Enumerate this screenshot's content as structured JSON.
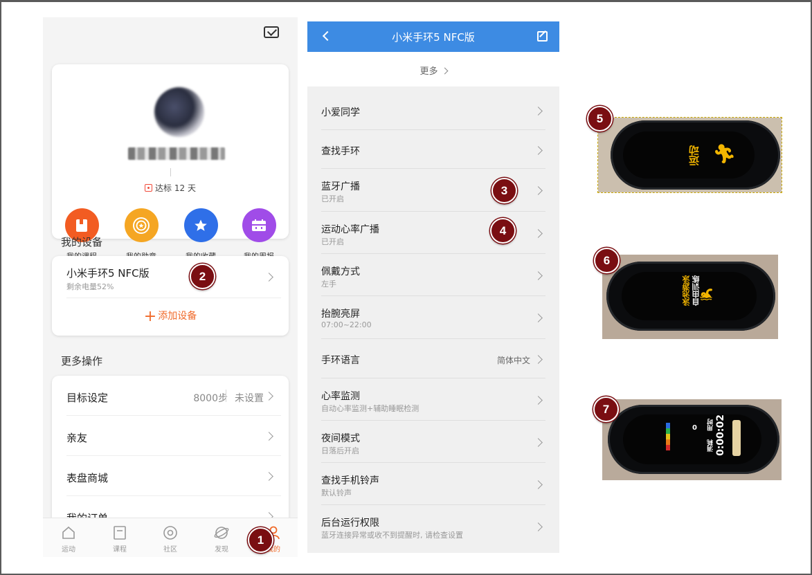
{
  "profile": {
    "badge_text": "达标 12 天",
    "shortcuts": [
      {
        "label": "我的课程",
        "color": "#f25c22"
      },
      {
        "label": "我的勋章",
        "color": "#f5a623"
      },
      {
        "label": "我的收藏",
        "color": "#2f6fe8"
      },
      {
        "label": "我的周报",
        "color": "#a04ce8"
      }
    ],
    "devices_title": "我的设备",
    "device": {
      "name": "小米手环5 NFC版",
      "battery": "剩余电量52%"
    },
    "add_device": "添加设备",
    "more_ops_title": "更多操作",
    "ops": [
      {
        "label": "目标设定",
        "value": "8000步",
        "value2": "未设置"
      },
      {
        "label": "亲友"
      },
      {
        "label": "表盘商城"
      },
      {
        "label": "我的订单"
      }
    ],
    "tabs": [
      "运动",
      "课程",
      "社区",
      "发现",
      "我的"
    ]
  },
  "device_settings": {
    "title": "小米手环5 NFC版",
    "more": "更多",
    "rows": [
      {
        "label": "小爱同学",
        "sub": "",
        "value": ""
      },
      {
        "label": "查找手环",
        "sub": "",
        "value": ""
      },
      {
        "label": "蓝牙广播",
        "sub": "已开启",
        "value": ""
      },
      {
        "label": "运动心率广播",
        "sub": "已开启",
        "value": ""
      },
      {
        "label": "佩戴方式",
        "sub": "左手",
        "value": ""
      },
      {
        "label": "抬腕亮屏",
        "sub": "07:00~22:00",
        "value": ""
      },
      {
        "label": "手环语言",
        "sub": "",
        "value": "简体中文"
      },
      {
        "label": "心率监测",
        "sub": "自动心率监测+辅助睡眠检测",
        "value": ""
      },
      {
        "label": "夜间模式",
        "sub": "日落后开启",
        "value": ""
      },
      {
        "label": "查找手机铃声",
        "sub": "默认铃声",
        "value": ""
      },
      {
        "label": "后台运行权限",
        "sub": "蓝牙连接异常或收不到提醒时, 请检查设置",
        "value": ""
      }
    ]
  },
  "photos": {
    "p5": {
      "text": "运动"
    },
    "p6": {
      "line1": "泳池游泳",
      "line2": "自由训练"
    },
    "p7": {
      "time": "0:00:02",
      "l1": "用时",
      "l2": "消耗",
      "unit": "0"
    }
  },
  "markers": [
    "1",
    "2",
    "3",
    "4",
    "5",
    "6",
    "7"
  ]
}
